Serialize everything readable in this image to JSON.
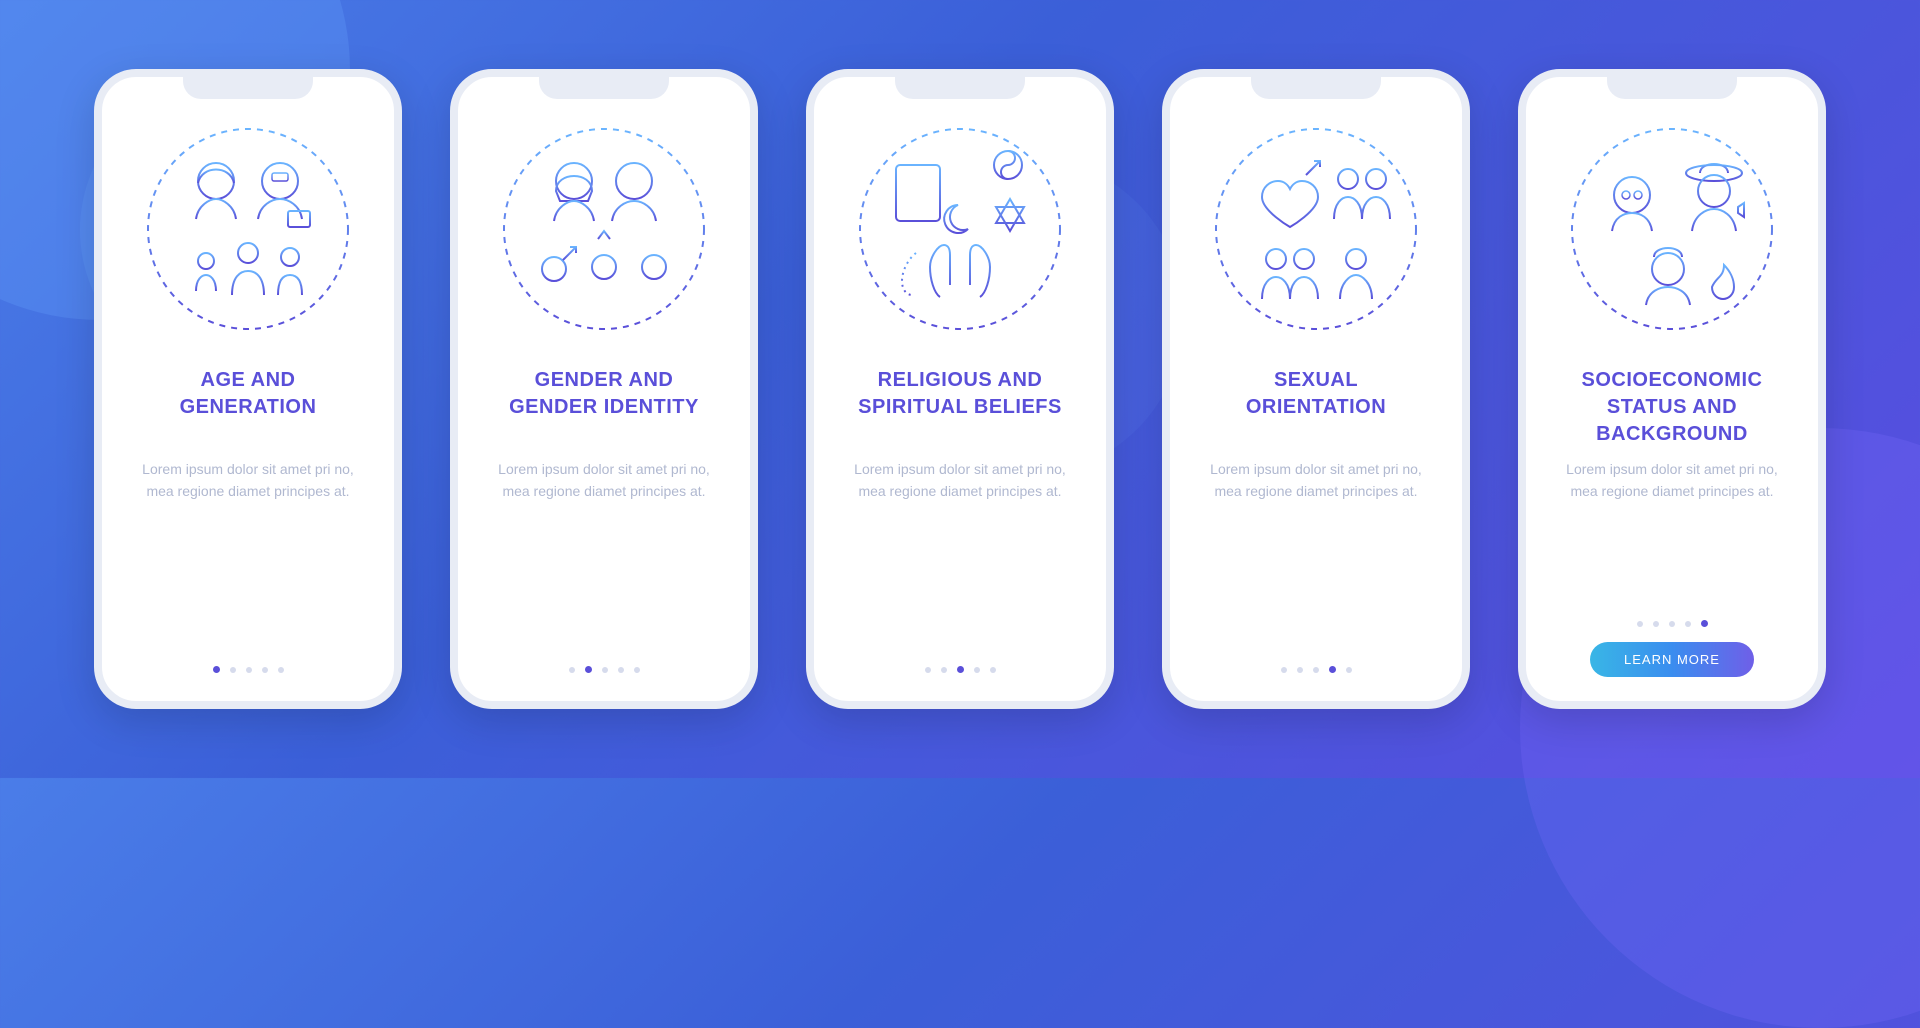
{
  "colors": {
    "title": "#5a4fd9",
    "desc": "#b0b8d0",
    "dot_active": "#5a4fd9",
    "cta_gradient": [
      "#39b6e6",
      "#3a8def",
      "#6f5fe8"
    ]
  },
  "lorem": "Lorem ipsum dolor sit amet pri no, mea regione diamet principes at.",
  "cta_label": "LEARN MORE",
  "screens": [
    {
      "title": "AGE AND\nGENERATION",
      "icon": "age-generation-icon",
      "active_index": 0
    },
    {
      "title": "GENDER AND\nGENDER IDENTITY",
      "icon": "gender-identity-icon",
      "active_index": 1
    },
    {
      "title": "RELIGIOUS AND\nSPIRITUAL BELIEFS",
      "icon": "religious-beliefs-icon",
      "active_index": 2
    },
    {
      "title": "SEXUAL\nORIENTATION",
      "icon": "sexual-orientation-icon",
      "active_index": 3
    },
    {
      "title": "SOCIOECONOMIC\nSTATUS AND\nBACKGROUND",
      "icon": "socioeconomic-status-icon",
      "active_index": 4,
      "cta": true
    }
  ],
  "dot_count": 5
}
